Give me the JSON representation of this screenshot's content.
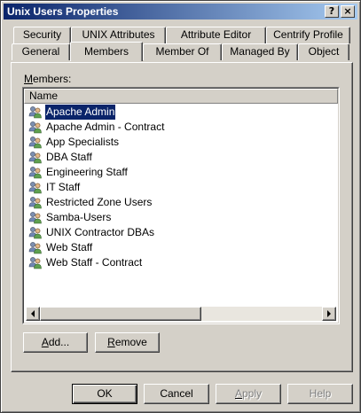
{
  "window": {
    "title": "Unix Users Properties",
    "help_glyph": "?",
    "close_glyph": "×"
  },
  "tabs_back": [
    {
      "label": "Security"
    },
    {
      "label": "UNIX Attributes"
    },
    {
      "label": "Attribute Editor"
    },
    {
      "label": "Centrify Profile"
    }
  ],
  "tabs_front": [
    {
      "label": "General"
    },
    {
      "label": "Members",
      "active": true
    },
    {
      "label": "Member Of"
    },
    {
      "label": "Managed By"
    },
    {
      "label": "Object"
    }
  ],
  "members": {
    "label_first": "M",
    "label_rest": "embers:",
    "column_header": "Name",
    "items": [
      {
        "name": "Apache Admin"
      },
      {
        "name": "Apache Admin - Contract"
      },
      {
        "name": "App Specialists"
      },
      {
        "name": "DBA Staff"
      },
      {
        "name": "Engineering Staff"
      },
      {
        "name": "IT Staff"
      },
      {
        "name": "Restricted Zone Users"
      },
      {
        "name": "Samba-Users"
      },
      {
        "name": "UNIX Contractor DBAs"
      },
      {
        "name": "Web Staff"
      },
      {
        "name": "Web Staff - Contract"
      }
    ],
    "selected_index": 0
  },
  "actions": {
    "add_first": "A",
    "add_rest": "dd...",
    "remove_first": "R",
    "remove_rest": "emove"
  },
  "footer": {
    "ok": "OK",
    "cancel": "Cancel",
    "apply_first": "A",
    "apply_rest": "pply",
    "help": "Help"
  },
  "colors": {
    "face": "#d4d0c8",
    "selection": "#0a246a",
    "title_start": "#0a246a",
    "title_end": "#a6caf0"
  }
}
